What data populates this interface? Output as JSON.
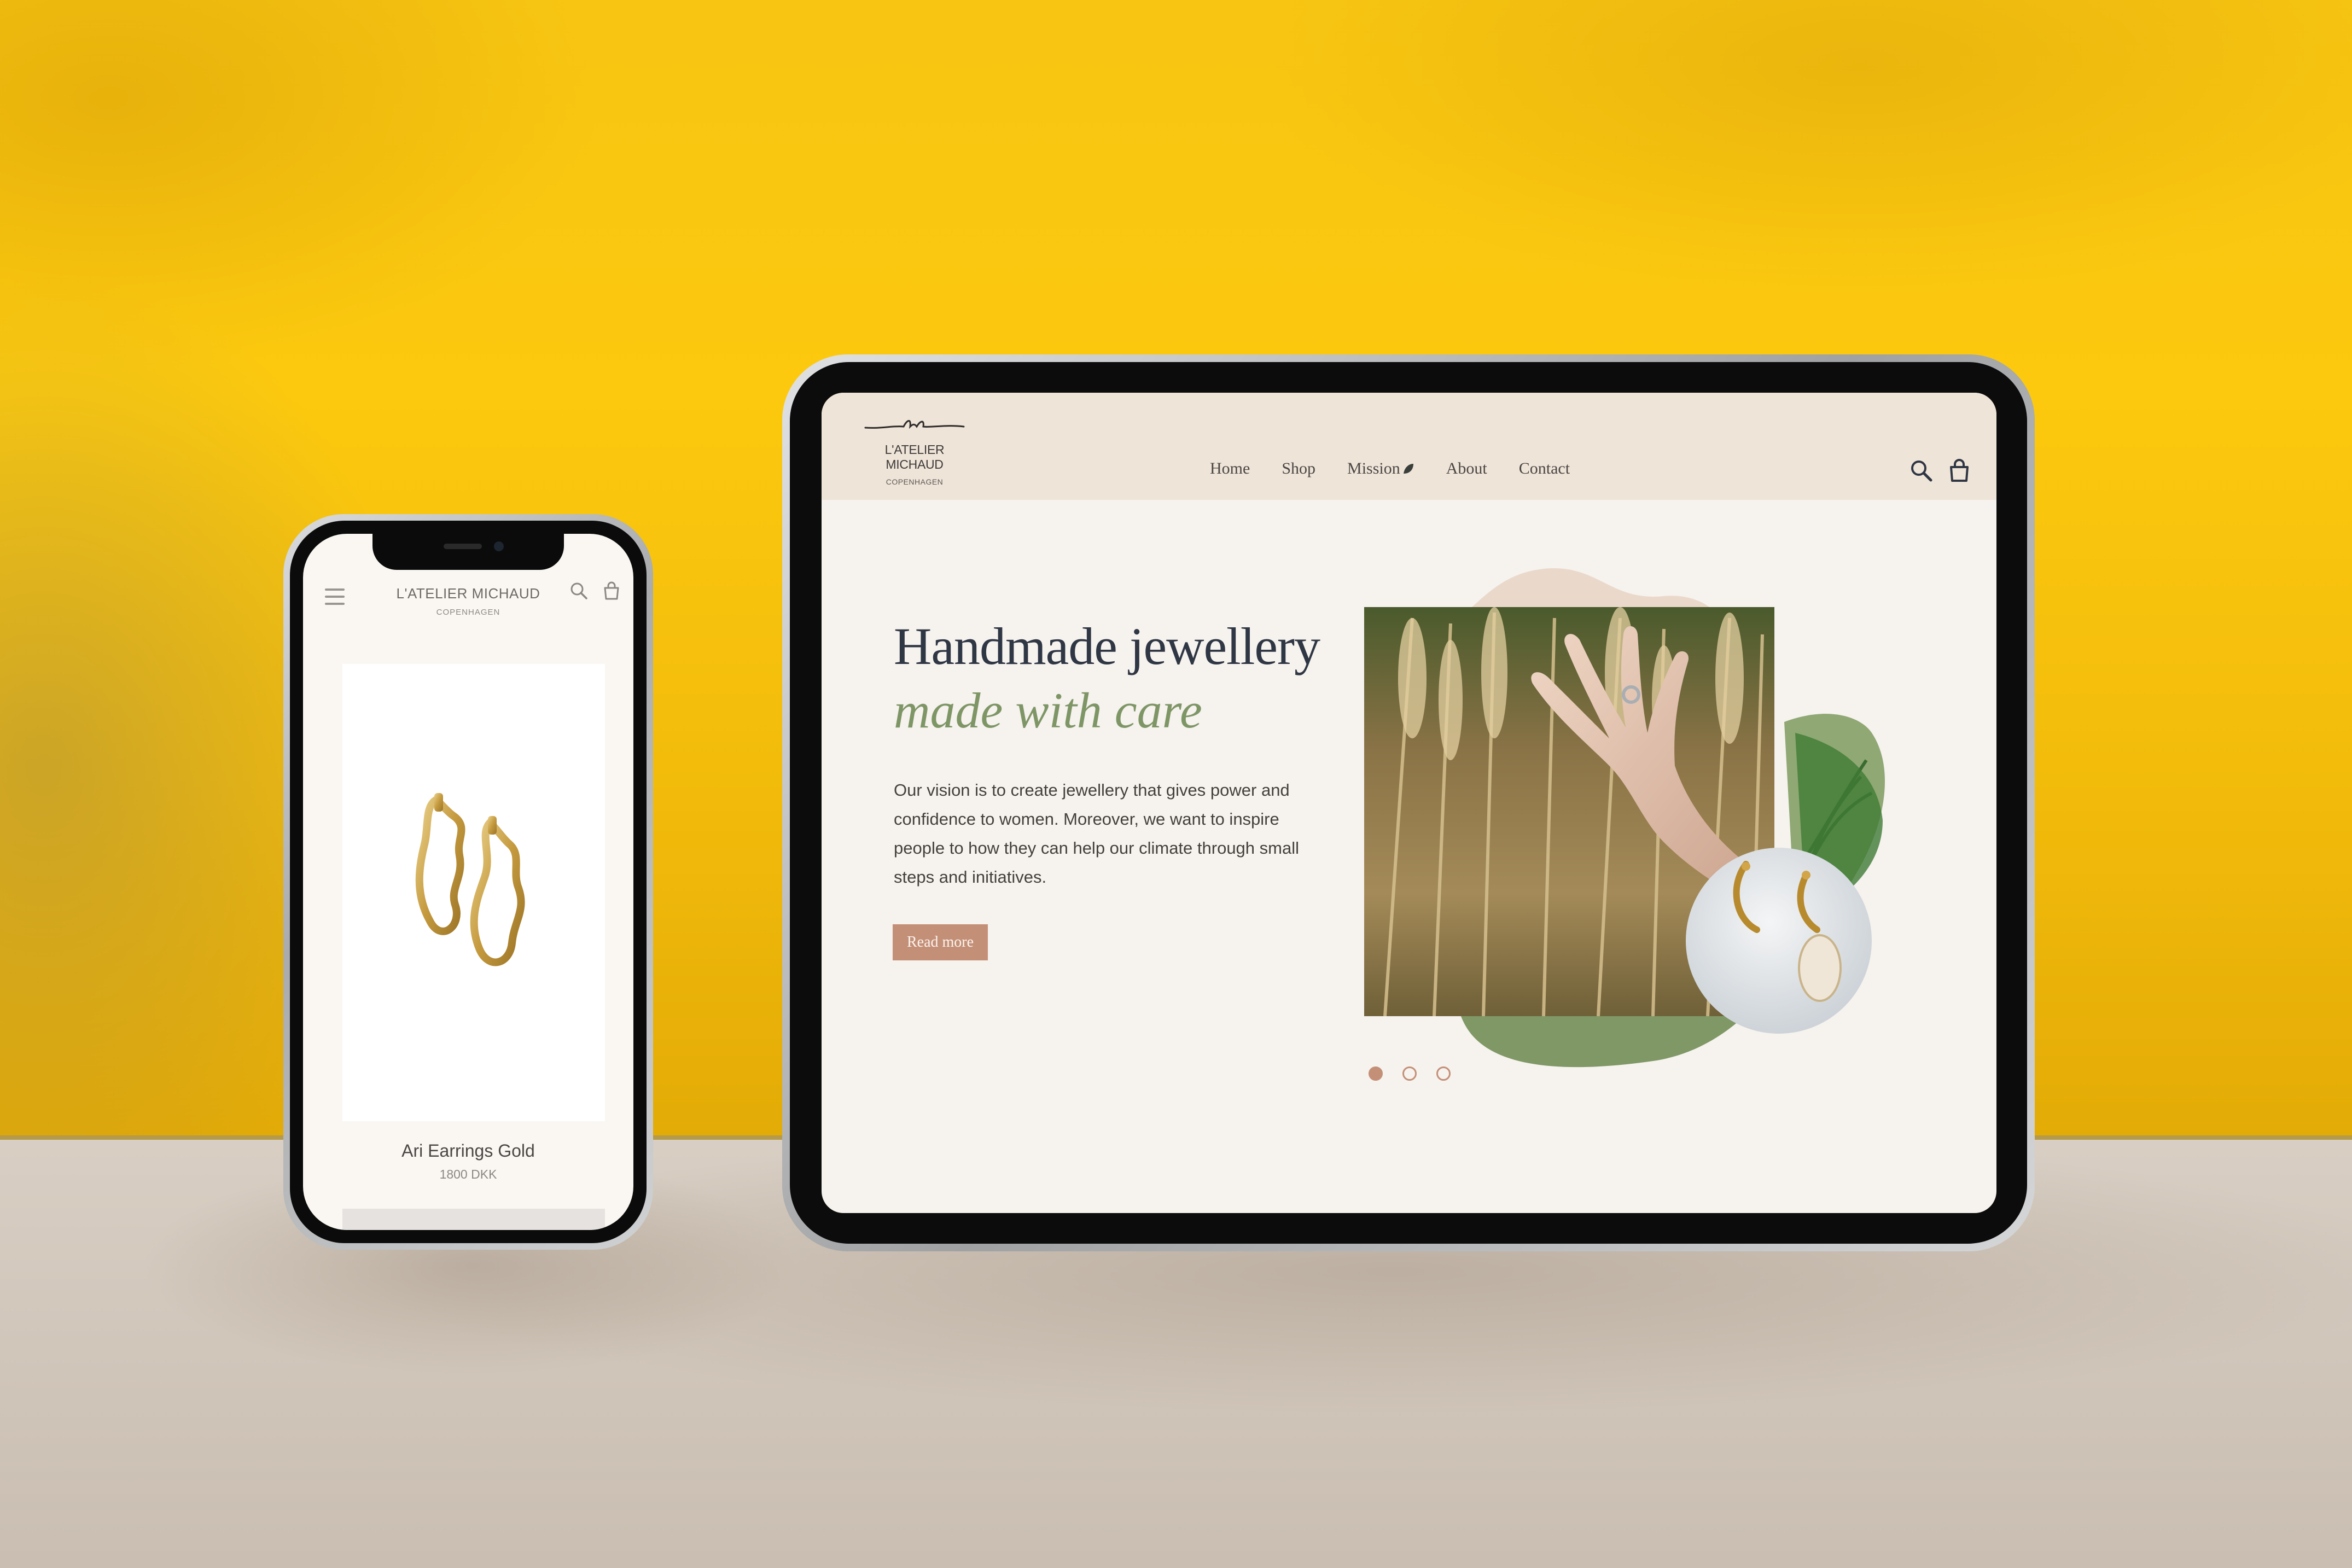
{
  "phone": {
    "brand_name": "L'ATELIER MICHAUD",
    "brand_city": "COPENHAGEN",
    "product": {
      "name": "Ari Earrings Gold",
      "price": "1800 DKK"
    },
    "icons": [
      "menu-icon",
      "search-icon",
      "bag-icon"
    ]
  },
  "tablet": {
    "brand_name": "L'ATELIER MICHAUD",
    "brand_city": "COPENHAGEN",
    "nav": [
      {
        "label": "Home"
      },
      {
        "label": "Shop"
      },
      {
        "label": "Mission"
      },
      {
        "label": "About"
      },
      {
        "label": "Contact"
      }
    ],
    "hero": {
      "headline_1": "Handmade jewellery",
      "headline_2": "made with care",
      "body": "Our vision is to create jewellery that gives power and confidence to women. Moreover, we want to inspire people to how they can help our climate through small steps and initiatives.",
      "button": "Read more"
    },
    "carousel": {
      "slides": 3,
      "active_index": 0
    },
    "icons": [
      "search-icon",
      "bag-icon",
      "leaf-icon"
    ]
  },
  "colors": {
    "wall": "#fcc90e",
    "accent_terracotta": "#c48f77",
    "accent_sage": "#7e9666",
    "headline_navy": "#2f3644",
    "nav_bg": "#efe4d8"
  }
}
